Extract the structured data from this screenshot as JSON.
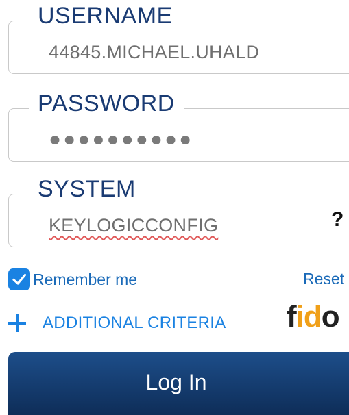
{
  "username": {
    "label": "USERNAME",
    "value": "44845.MICHAEL.UHALD"
  },
  "password": {
    "label": "PASSWORD",
    "value": "●●●●●●●●●●"
  },
  "system": {
    "label": "SYSTEM",
    "value": "KEYLOGICCONFIG",
    "help": "?"
  },
  "remember": {
    "label": "Remember me",
    "checked": true
  },
  "reset": {
    "label": "Reset"
  },
  "additional": {
    "label": "ADDITIONAL CRITERIA"
  },
  "logo": {
    "part1": "f",
    "part2": "id",
    "part3": "o"
  },
  "login": {
    "label": "Log In"
  },
  "colors": {
    "accent": "#1a82e2",
    "label_navy": "#1a3b73",
    "button": "#173f72",
    "logo_orange": "#f0a019"
  }
}
